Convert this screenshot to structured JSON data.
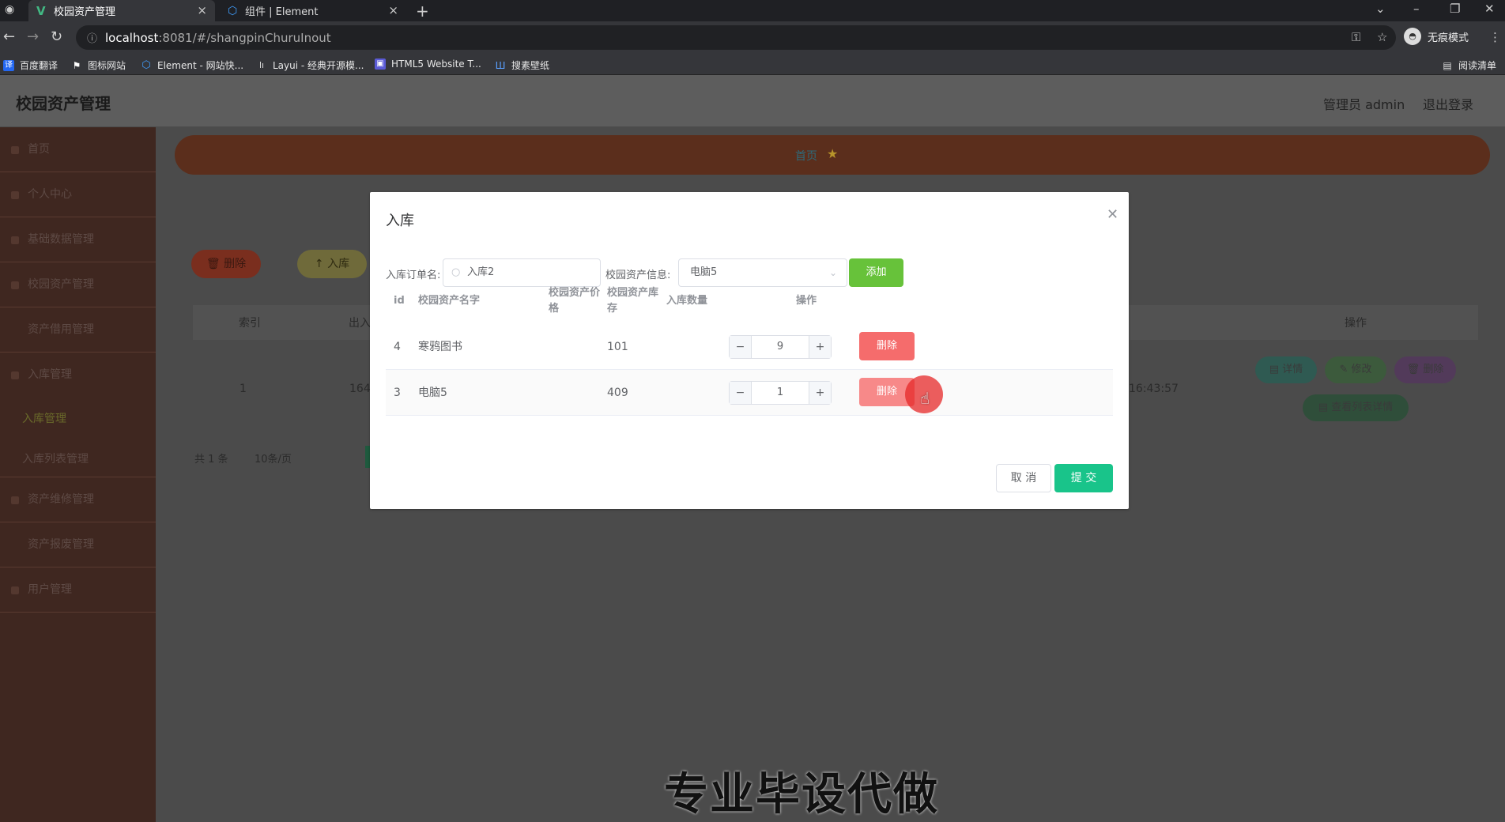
{
  "browser": {
    "tabs": [
      {
        "title": "校园资产管理",
        "active": true,
        "icon": "vue-logo-icon"
      },
      {
        "title": "组件 | Element",
        "active": false,
        "icon": "element-logo-icon"
      }
    ],
    "url_host": "localhost",
    "url_path": ":8081/#/shangpinChuruInout",
    "profile_label": "无痕模式",
    "reading_list": "阅读清单",
    "bookmarks": [
      "百度翻译",
      "图标网站",
      "Element - 网站快...",
      "Layui - 经典开源模...",
      "HTML5 Website T...",
      "搜素壁纸"
    ]
  },
  "app": {
    "title": "校园资产管理",
    "user_label": "管理员 admin",
    "logout_label": "退出登录",
    "breadcrumb": "首页"
  },
  "sidebar": {
    "items": [
      {
        "label": "首页"
      },
      {
        "label": "个人中心"
      },
      {
        "label": "基础数据管理"
      },
      {
        "label": "校园资产管理"
      },
      {
        "label": "资产借用管理"
      },
      {
        "label": "入库管理"
      },
      {
        "label": "入库管理"
      },
      {
        "label": "入库列表管理"
      },
      {
        "label": "资产维修管理"
      },
      {
        "label": "资产报废管理"
      },
      {
        "label": "用户管理"
      }
    ]
  },
  "background": {
    "delete_label": "删除",
    "inbound_label": "入库",
    "col_index": "索引",
    "col_out": "出入",
    "col_op": "操作",
    "row_index": "1",
    "row_frag": "164",
    "row_time": "16:43:57",
    "details_label": "详情",
    "edit_label": "修改",
    "delete_row_label": "删除",
    "view_list_label": "查看列表详情",
    "total": "共 1 条",
    "page_size": "10条/页"
  },
  "dialog": {
    "title": "入库",
    "order_label": "入库订单名:",
    "order_value": "入库2",
    "asset_label": "校园资产信息:",
    "asset_value": "电脑5",
    "add_label": "添加",
    "columns": [
      "id",
      "校园资产名字",
      "校园资产价格",
      "校园资产库存",
      "入库数量",
      "操作"
    ],
    "rows": [
      {
        "id": "4",
        "name": "寒鸦图书",
        "price": "",
        "stock": "101",
        "qty": "9",
        "action": "删除"
      },
      {
        "id": "3",
        "name": "电脑5",
        "price": "",
        "stock": "409",
        "qty": "1",
        "action": "删除"
      }
    ],
    "cancel_label": "取 消",
    "submit_label": "提 交"
  },
  "watermark": "专业毕设代做"
}
